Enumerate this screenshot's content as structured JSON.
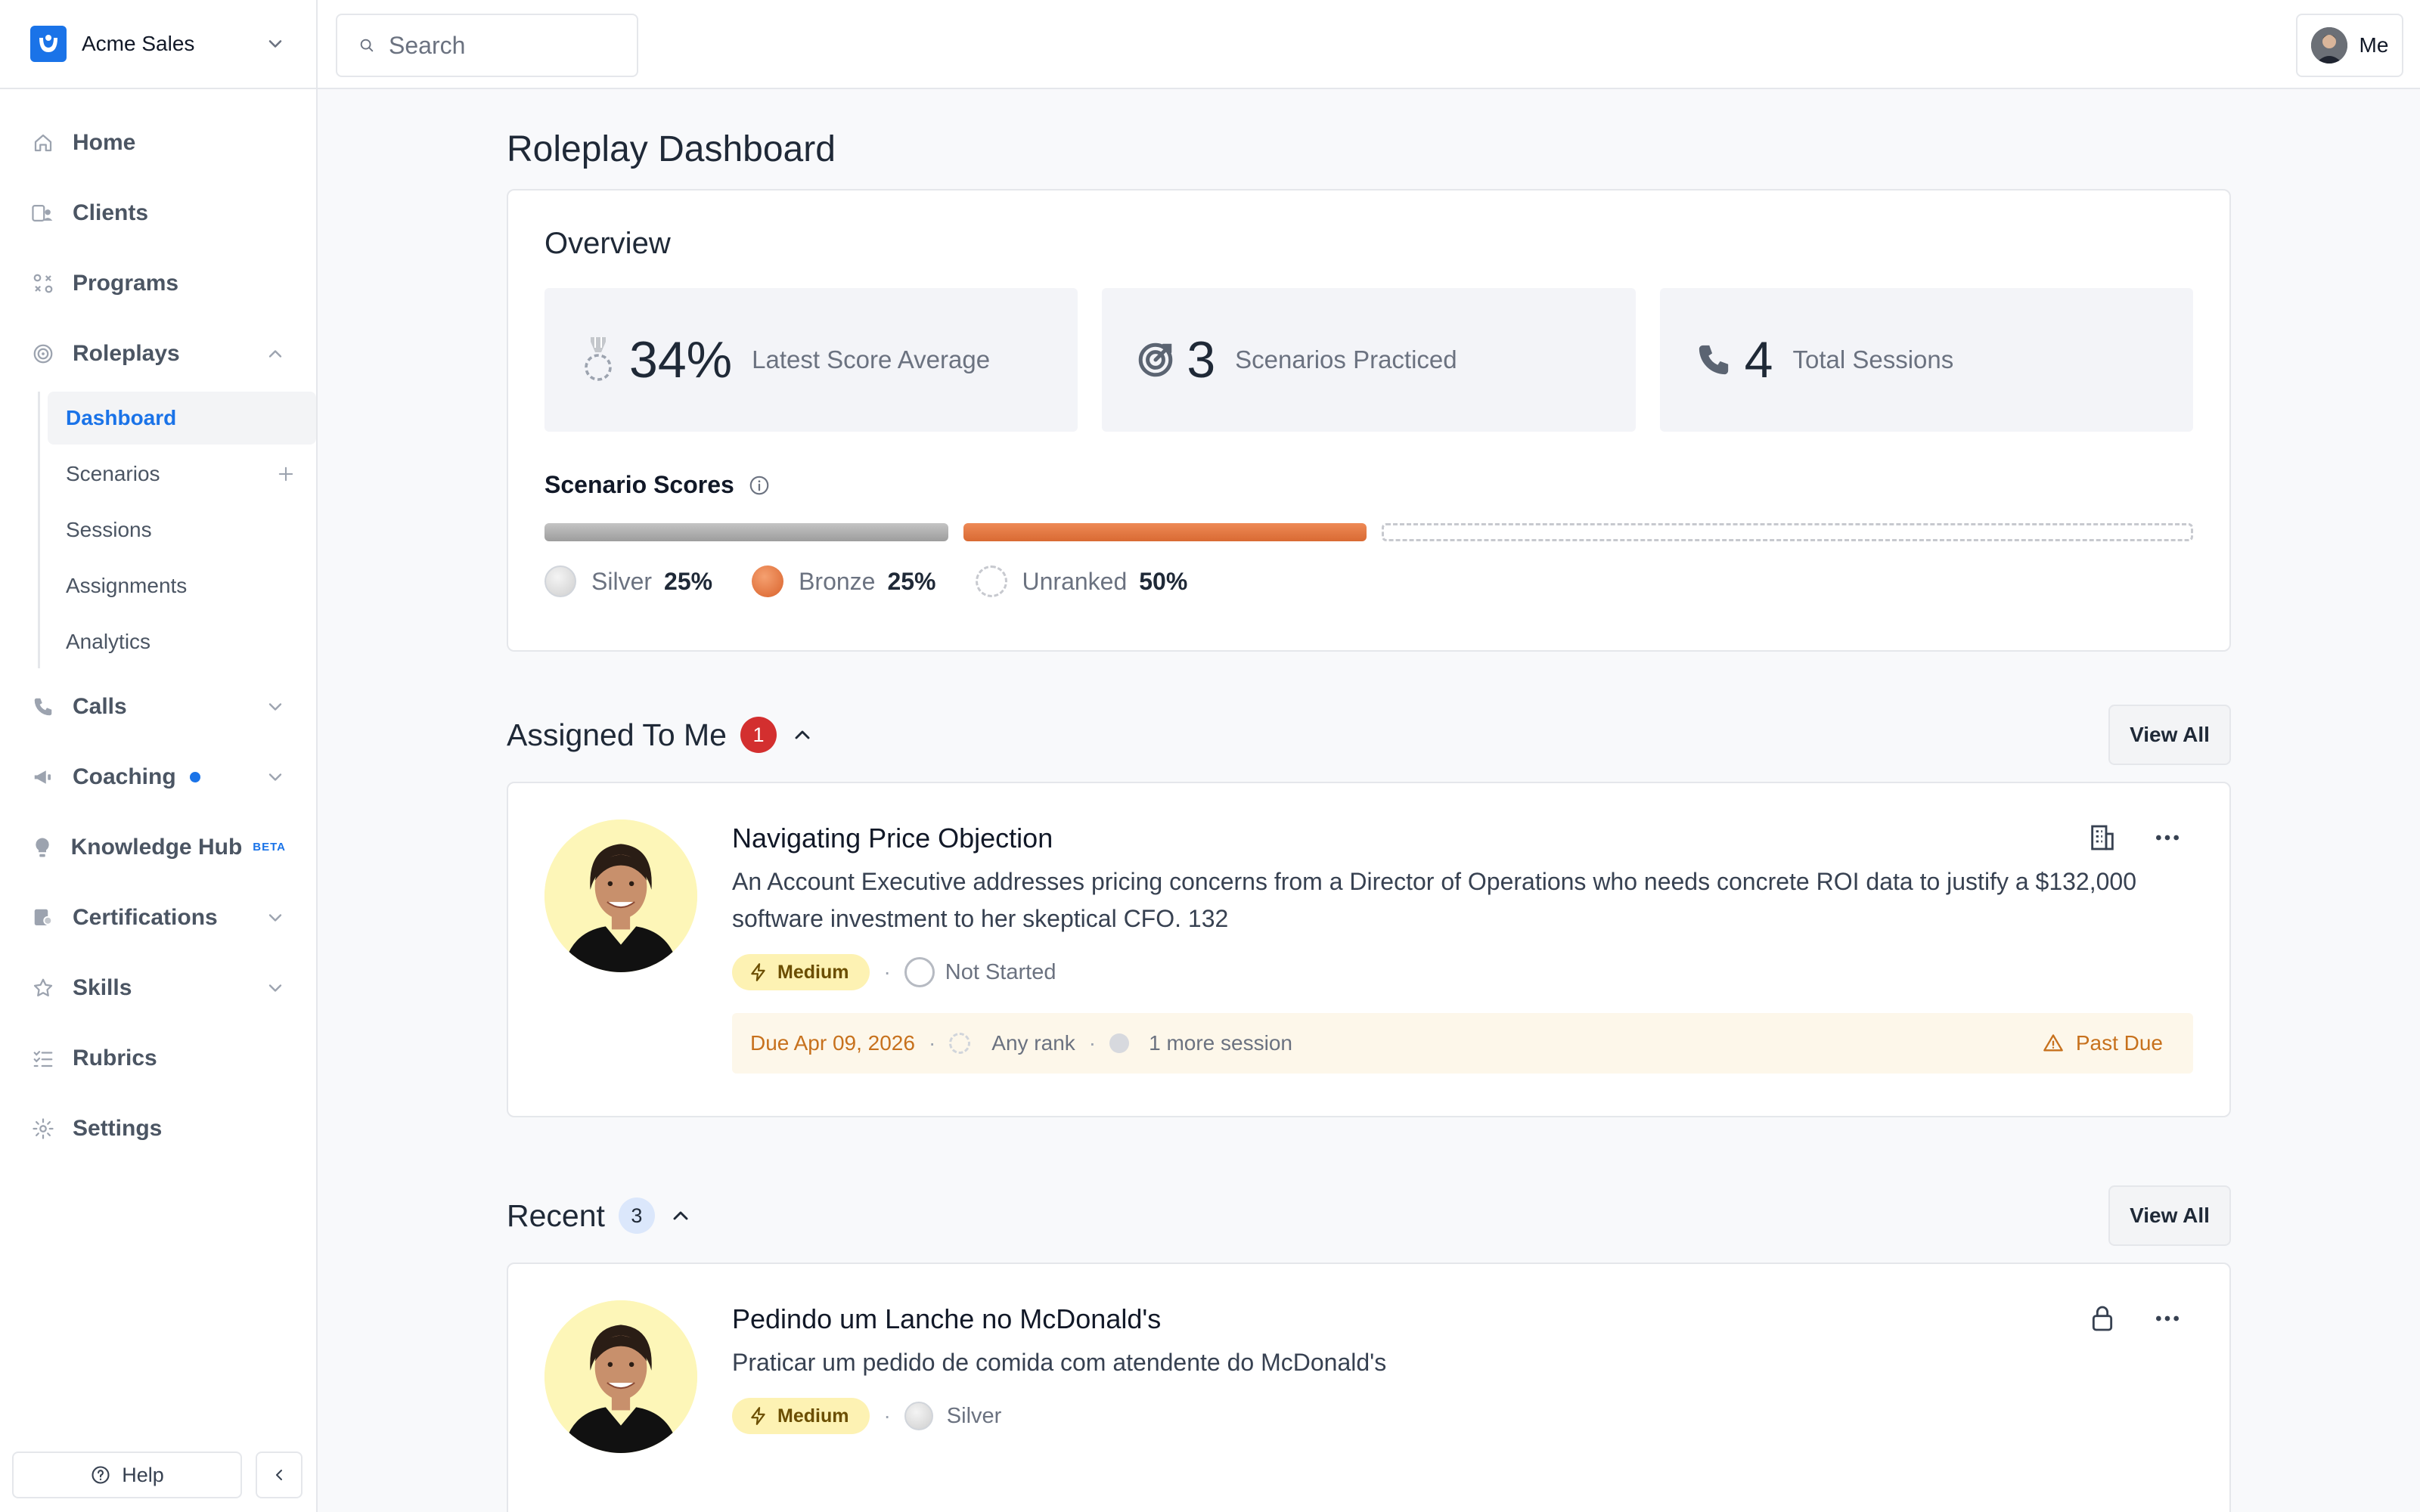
{
  "workspace": {
    "name": "Acme Sales"
  },
  "search": {
    "placeholder": "Search"
  },
  "user": {
    "label": "Me"
  },
  "sidebar": {
    "items": [
      {
        "label": "Home",
        "icon": "home-icon"
      },
      {
        "label": "Clients",
        "icon": "clients-icon"
      },
      {
        "label": "Programs",
        "icon": "programs-icon"
      },
      {
        "label": "Roleplays",
        "icon": "target-icon",
        "expanded": true
      }
    ],
    "roleplay_sub": [
      {
        "label": "Dashboard",
        "active": true
      },
      {
        "label": "Scenarios"
      },
      {
        "label": "Sessions"
      },
      {
        "label": "Assignments"
      },
      {
        "label": "Analytics"
      }
    ],
    "items_after": [
      {
        "label": "Calls",
        "icon": "phone-icon"
      },
      {
        "label": "Coaching",
        "icon": "megaphone-icon"
      },
      {
        "label": "Knowledge Hub",
        "icon": "lightbulb-icon",
        "badge": "BETA"
      },
      {
        "label": "Certifications",
        "icon": "certificate-icon"
      },
      {
        "label": "Skills",
        "icon": "star-icon"
      },
      {
        "label": "Rubrics",
        "icon": "checklist-icon"
      },
      {
        "label": "Settings",
        "icon": "gear-icon"
      }
    ],
    "help_label": "Help"
  },
  "page": {
    "title": "Roleplay Dashboard"
  },
  "overview": {
    "title": "Overview",
    "stats": [
      {
        "value": "34%",
        "label": "Latest Score Average",
        "icon": "medal-icon"
      },
      {
        "value": "3",
        "label": "Scenarios Practiced",
        "icon": "target-icon"
      },
      {
        "value": "4",
        "label": "Total Sessions",
        "icon": "phone-icon"
      }
    ],
    "scores_title": "Scenario Scores",
    "scores": [
      {
        "name": "Silver",
        "percent": "25%",
        "fraction": 0.25,
        "color": "#b3b3b3"
      },
      {
        "name": "Bronze",
        "percent": "25%",
        "fraction": 0.25,
        "color": "#e2763f"
      },
      {
        "name": "Unranked",
        "percent": "50%",
        "fraction": 0.5,
        "color": "#c7c9cf"
      }
    ]
  },
  "assigned": {
    "title": "Assigned To Me",
    "count": "1",
    "view_all": "View All",
    "card": {
      "title": "Navigating Price Objection",
      "description": "An Account Executive addresses pricing concerns from a Director of Operations who needs concrete ROI data to justify a $132,000 software investment to her skeptical CFO. 132",
      "difficulty": "Medium",
      "status": "Not Started",
      "due": "Due Apr 09, 2026",
      "rank": "Any rank",
      "sessions": "1 more session",
      "past_due": "Past Due"
    }
  },
  "recent": {
    "title": "Recent",
    "count": "3",
    "view_all": "View All",
    "card": {
      "title": "Pedindo um Lanche no McDonald's",
      "description": "Praticar um pedido de comida com atendente do McDonald's",
      "difficulty": "Medium",
      "rank": "Silver"
    }
  }
}
